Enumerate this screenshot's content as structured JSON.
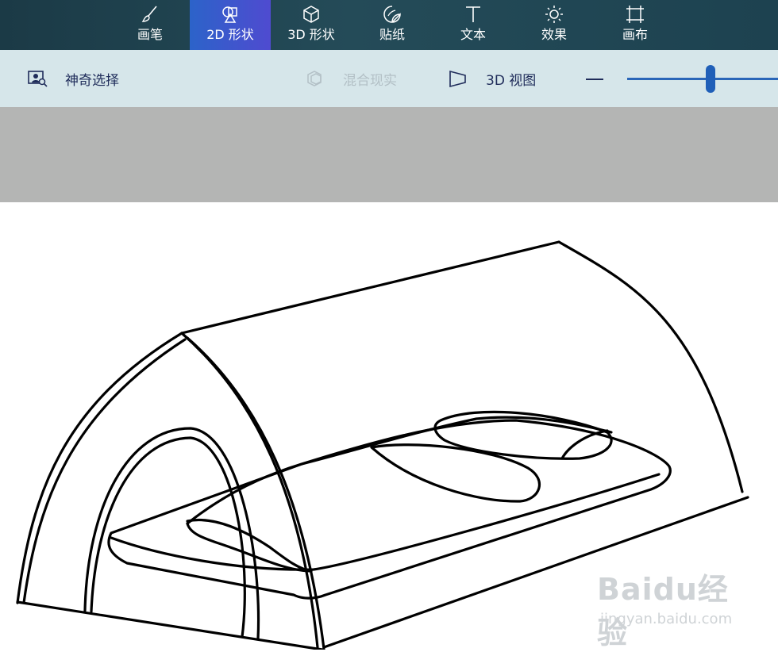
{
  "tabs": [
    {
      "label": "画笔",
      "icon": "brush-icon"
    },
    {
      "label": "2D 形状",
      "icon": "2d-shapes-icon",
      "active": true
    },
    {
      "label": "3D 形状",
      "icon": "3d-cube-icon"
    },
    {
      "label": "贴纸",
      "icon": "sticker-icon"
    },
    {
      "label": "文本",
      "icon": "text-icon"
    },
    {
      "label": "效果",
      "icon": "sun-icon"
    },
    {
      "label": "画布",
      "icon": "canvas-crop-icon"
    }
  ],
  "toolbar": {
    "magic_select": "神奇选择",
    "mixed_reality": "混合现实",
    "view_3d": "3D 视图",
    "zoom_slider_fraction": 0.52
  },
  "colors": {
    "tabbar": "#1d4250",
    "active_tab": "#3b57cc",
    "toolbar": "#d6e6ea",
    "workspace": "#b4b5b4",
    "slider": "#1f5fb8"
  },
  "watermark": {
    "logo": "Baidu经验",
    "url": "jingyan.baidu.com"
  }
}
